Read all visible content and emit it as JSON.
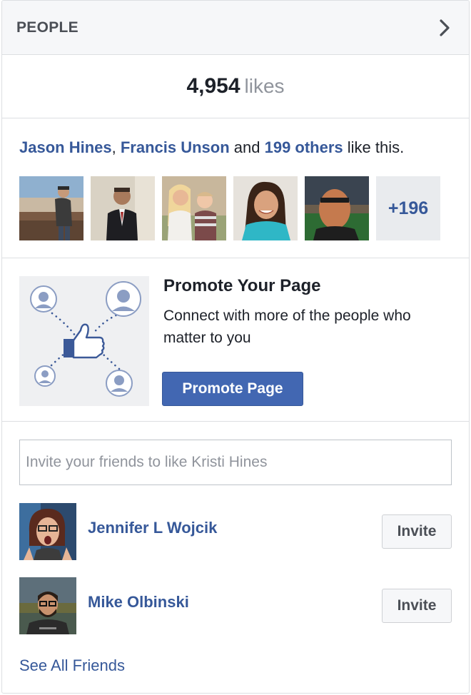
{
  "header": {
    "title": "PEOPLE",
    "chevron_icon": "chevron-right-icon"
  },
  "likes": {
    "count": "4,954",
    "word": "likes"
  },
  "social": {
    "friend1": "Jason Hines",
    "separator": ", ",
    "friend2": "Francis Unson",
    "and_text": " and ",
    "others": "199 others",
    "suffix": " like this.",
    "faces": [
      "profile-photo-man-canyon",
      "profile-photo-man-suit",
      "profile-photo-woman-baby",
      "profile-photo-woman-smiling",
      "profile-photo-man-stadium"
    ],
    "more_count": "+196"
  },
  "promo": {
    "image_icon": "promote-network-like-icon",
    "title": "Promote Your Page",
    "description": "Connect with more of the people who matter to you",
    "button_label": "Promote Page"
  },
  "invite": {
    "placeholder": "Invite your friends to like Kristi Hines",
    "friends": [
      {
        "name": "Jennifer L Wojcik",
        "button": "Invite"
      },
      {
        "name": "Mike Olbinski",
        "button": "Invite"
      }
    ],
    "see_all": "See All Friends"
  },
  "colors": {
    "link": "#365899",
    "primary_button": "#4267b2",
    "header_bg": "#f6f7f9",
    "border": "#dddfe2"
  }
}
